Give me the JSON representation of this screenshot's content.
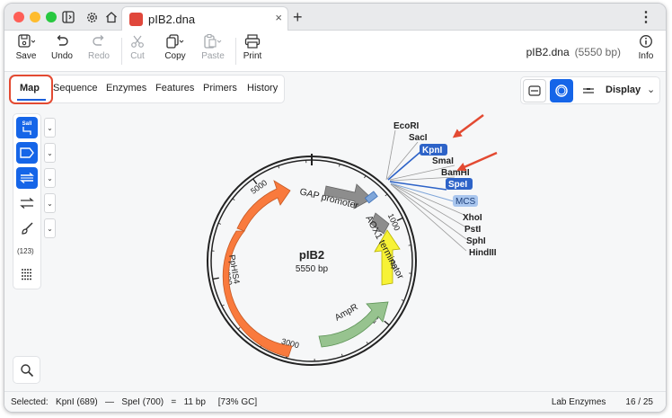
{
  "window": {
    "tab_title": "pIB2.dna",
    "new_tab_symbol": "+",
    "close_symbol": "×"
  },
  "toolbar": {
    "save": "Save",
    "undo": "Undo",
    "redo": "Redo",
    "cut": "Cut",
    "copy": "Copy",
    "paste": "Paste",
    "print": "Print",
    "info": "Info",
    "file_name": "pIB2.dna",
    "file_length": "(5550 bp)"
  },
  "view_tabs": [
    {
      "label": "Map",
      "active": true
    },
    {
      "label": "Sequence"
    },
    {
      "label": "Enzymes"
    },
    {
      "label": "Features"
    },
    {
      "label": "Primers"
    },
    {
      "label": "History"
    }
  ],
  "display": {
    "label": "Display"
  },
  "palette": {
    "enzyme_button_label": "SalI",
    "orf_label": "(123)"
  },
  "map": {
    "name": "pIB2",
    "length": "5550 bp",
    "total_bp": 5550,
    "ticks": [
      {
        "label": "1000",
        "bp": 1000
      },
      {
        "label": "2000",
        "bp": 2000
      },
      {
        "label": "3000",
        "bp": 3000
      },
      {
        "label": "4000",
        "bp": 4000
      },
      {
        "label": "5000",
        "bp": 5000
      }
    ],
    "features": [
      {
        "label": "GAP promoter",
        "color": "#8d8d8d"
      },
      {
        "label": "AOX1 terminator",
        "color": "#8d8d8d"
      },
      {
        "label": "ori",
        "color": "#f7f235"
      },
      {
        "label": "AmpR",
        "color": "#97c38f"
      },
      {
        "label": "PpHIS4",
        "color": "#f97a3d"
      }
    ],
    "mcs_label": "MCS",
    "enzymes": [
      {
        "name": "EcoRI",
        "selected": false
      },
      {
        "name": "SacI",
        "selected": false
      },
      {
        "name": "KpnI",
        "selected": true
      },
      {
        "name": "SmaI",
        "selected": false
      },
      {
        "name": "BamHI",
        "selected": false
      },
      {
        "name": "SpeI",
        "selected": true
      },
      {
        "name": "XhoI",
        "selected": false
      },
      {
        "name": "PstI",
        "selected": false
      },
      {
        "name": "SphI",
        "selected": false
      },
      {
        "name": "HindIII",
        "selected": false
      }
    ]
  },
  "status": {
    "selection": "Selected:   KpnI (689)   —   SpeI (700)   =   11 bp     [73% GC]",
    "enzyme_set": "Lab Enzymes",
    "enzyme_count": "16 / 25"
  },
  "colors": {
    "accent": "#1565e8",
    "highlight_red": "#e34a32"
  }
}
